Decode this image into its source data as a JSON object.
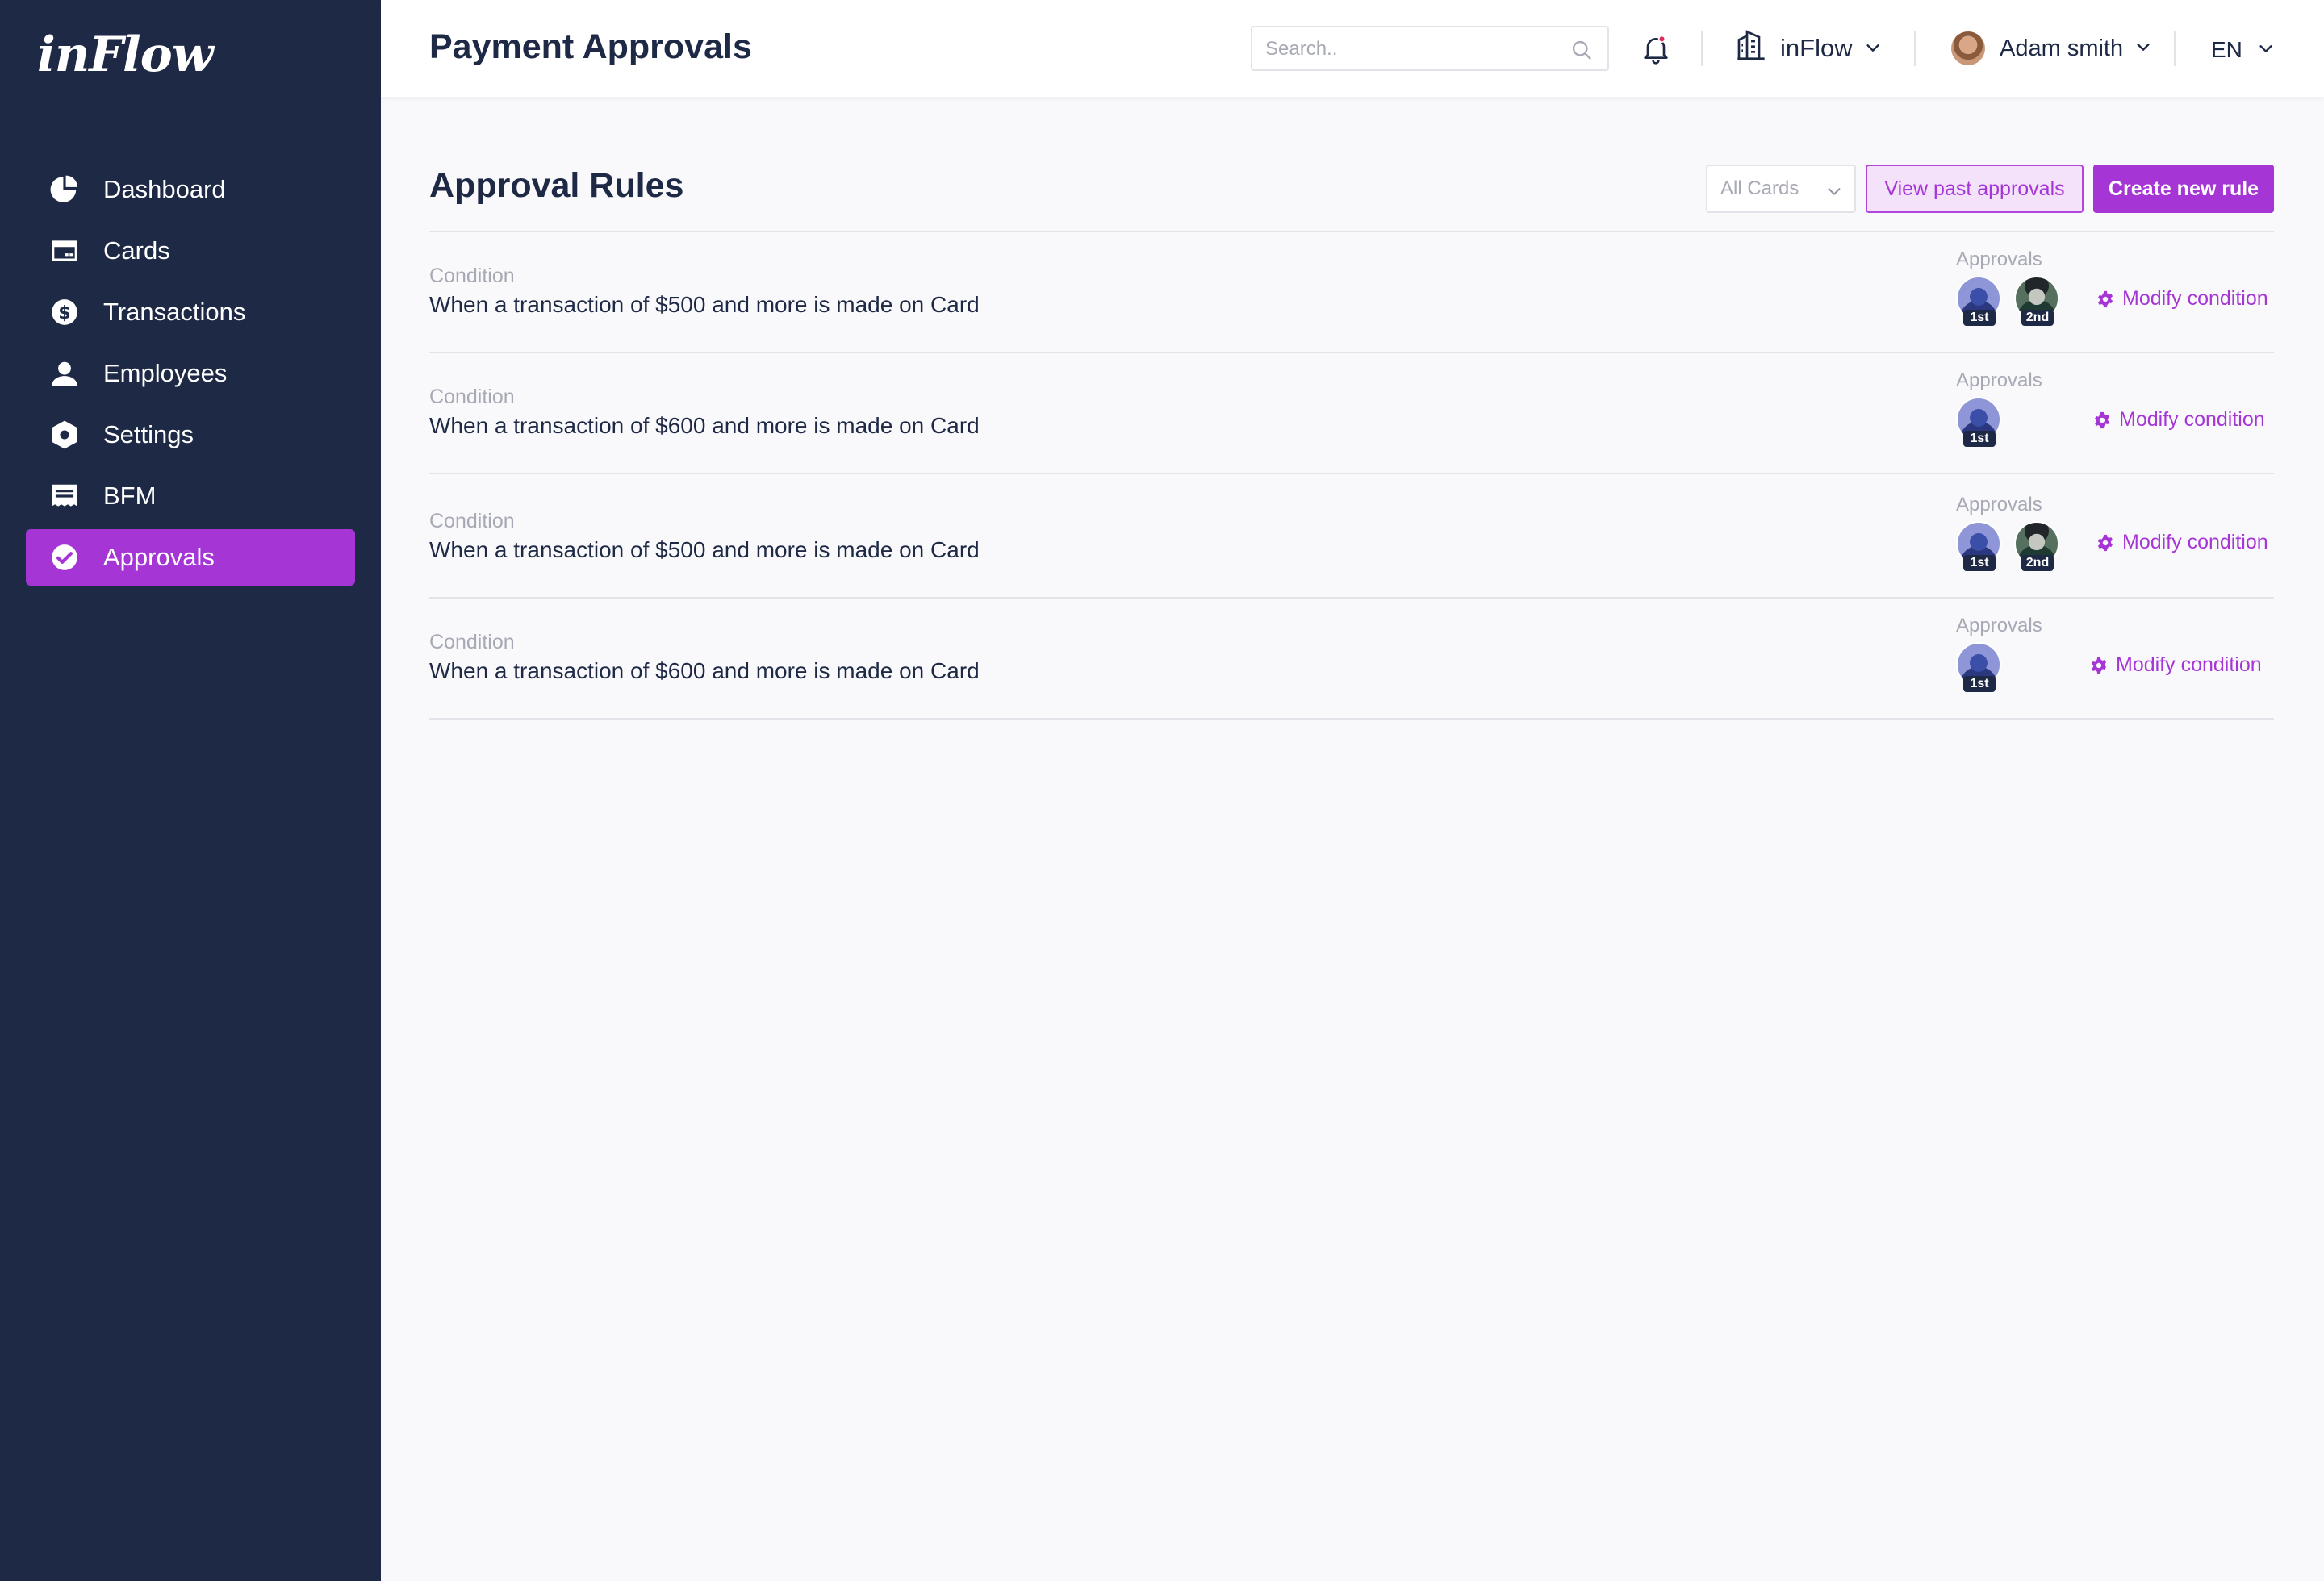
{
  "app": {
    "logo": "inFlow"
  },
  "colors": {
    "sidebar": "#1e2945",
    "accent": "#a635d6",
    "accent_light": "#f4e2fa"
  },
  "sidebar": {
    "items": [
      {
        "label": "Dashboard",
        "icon": "pie-chart-icon",
        "active": false
      },
      {
        "label": "Cards",
        "icon": "credit-card-icon",
        "active": false
      },
      {
        "label": "Transactions",
        "icon": "dollar-circle-icon",
        "active": false
      },
      {
        "label": "Employees",
        "icon": "person-icon",
        "active": false
      },
      {
        "label": "Settings",
        "icon": "hexagon-gear-icon",
        "active": false
      },
      {
        "label": "BFM",
        "icon": "receipt-icon",
        "active": false
      },
      {
        "label": "Approvals",
        "icon": "check-circle-icon",
        "active": true
      }
    ]
  },
  "header": {
    "title": "Payment Approvals",
    "search_placeholder": "Search..",
    "org_name": "inFlow",
    "user_name": "Adam smith",
    "language": "EN"
  },
  "main": {
    "section_title": "Approval Rules",
    "filter_value": "All Cards",
    "view_past_label": "View past approvals",
    "create_rule_label": "Create new rule",
    "rules": [
      {
        "condition_label": "Condition",
        "condition": "When a transaction of $500 and more is made on Card",
        "approvals_label": "Approvals",
        "approvers": [
          "1st",
          "2nd"
        ],
        "modify_label": "Modify condition"
      },
      {
        "condition_label": "Condition",
        "condition": "When a transaction of $600 and more is made on Card",
        "approvals_label": "Approvals",
        "approvers": [
          "1st"
        ],
        "modify_label": "Modify condition"
      },
      {
        "condition_label": "Condition",
        "condition": "When a transaction of $500 and more is made on Card",
        "approvals_label": "Approvals",
        "approvers": [
          "1st",
          "2nd"
        ],
        "modify_label": "Modify condition"
      },
      {
        "condition_label": "Condition",
        "condition": "When a transaction of $600 and more is made on Card",
        "approvals_label": "Approvals",
        "approvers": [
          "1st"
        ],
        "modify_label": "Modify condition"
      }
    ]
  }
}
